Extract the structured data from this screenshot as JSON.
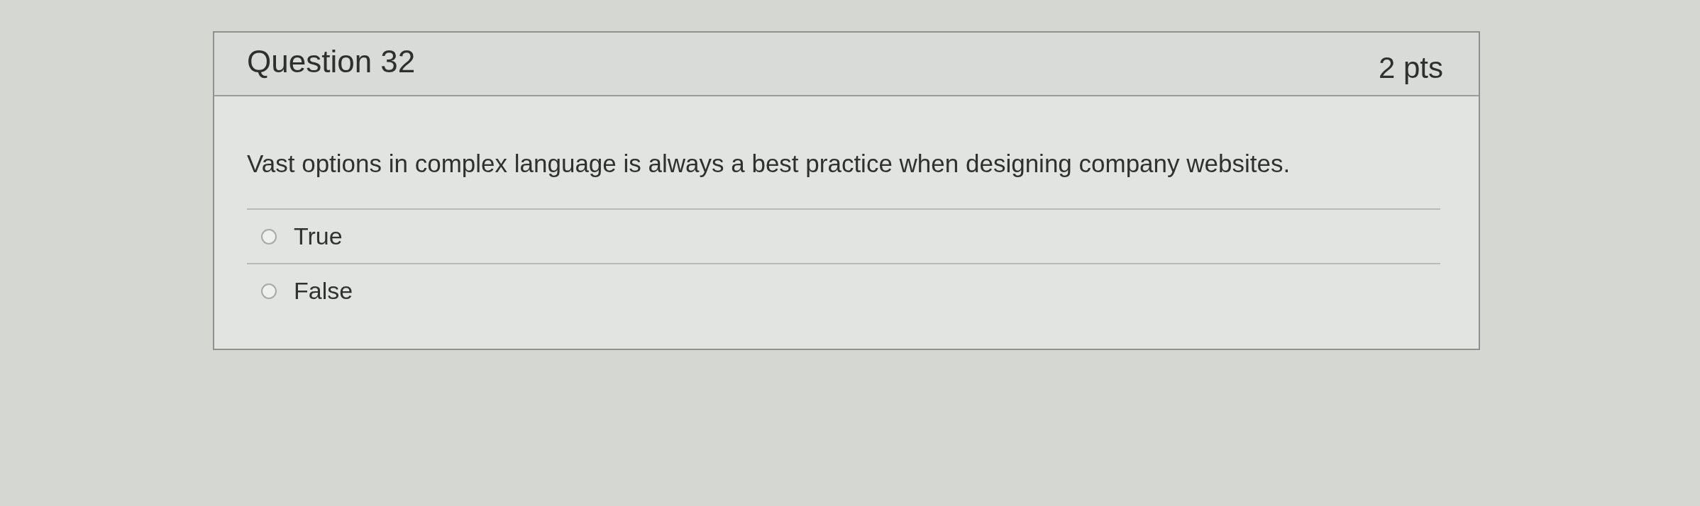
{
  "question": {
    "title": "Question 32",
    "points": "2 pts",
    "text": "Vast options in complex language is always a best practice when designing company websites.",
    "answers": [
      {
        "label": "True",
        "selected": false
      },
      {
        "label": "False",
        "selected": false
      }
    ]
  }
}
